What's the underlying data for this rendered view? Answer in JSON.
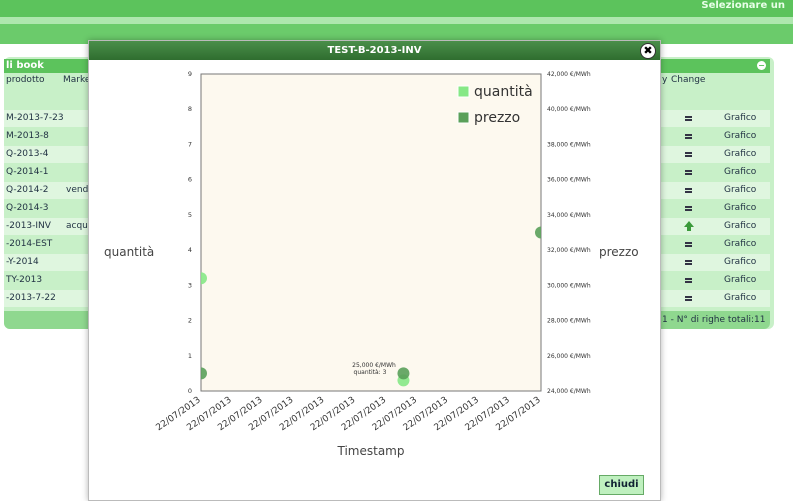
{
  "top": {
    "right_text": "Selezionare un"
  },
  "panel": {
    "title": "li book",
    "columns": {
      "prodotto": "prodotto",
      "market": "Marke",
      "y": "y",
      "change": "Change"
    },
    "rows": [
      {
        "prodotto": "M-2013-7-23",
        "market": "",
        "change": "eq",
        "link": "Grafico"
      },
      {
        "prodotto": "M-2013-8",
        "market": "",
        "change": "eq",
        "link": "Grafico"
      },
      {
        "prodotto": "Q-2013-4",
        "market": "",
        "change": "eq",
        "link": "Grafico"
      },
      {
        "prodotto": "Q-2014-1",
        "market": "",
        "change": "eq",
        "link": "Grafico"
      },
      {
        "prodotto": "Q-2014-2",
        "market": "vend",
        "change": "eq",
        "link": "Grafico"
      },
      {
        "prodotto": "Q-2014-3",
        "market": "",
        "change": "eq",
        "link": "Grafico"
      },
      {
        "prodotto": "-2013-INV",
        "market": "acqu",
        "change": "up",
        "link": "Grafico"
      },
      {
        "prodotto": "-2014-EST",
        "market": "",
        "change": "eq",
        "link": "Grafico"
      },
      {
        "prodotto": "-Y-2014",
        "market": "",
        "change": "eq",
        "link": "Grafico"
      },
      {
        "prodotto": "TY-2013",
        "market": "",
        "change": "eq",
        "link": "Grafico"
      },
      {
        "prodotto": "-2013-7-22",
        "market": "",
        "change": "eq",
        "link": "Grafico"
      }
    ],
    "footer": "1 - N° di righe totali:11"
  },
  "modal": {
    "title": "TEST-B-2013-INV",
    "close_label": "✖",
    "button": "chiudi"
  },
  "colors": {
    "quantita": "#86e886",
    "prezzo": "#5aa05a",
    "plot_bg": "#fdf9ef"
  },
  "chart_data": {
    "type": "scatter",
    "xlabel": "Timestamp",
    "ylabel": "quantità",
    "y2label": "prezzo",
    "ylim": [
      0,
      9
    ],
    "y2lim": [
      24000,
      42000
    ],
    "yticks": [
      "0",
      "1",
      "2",
      "3",
      "4",
      "5",
      "6",
      "7",
      "8",
      "9"
    ],
    "y2ticks": [
      "24,000 €/MWh",
      "26,000 €/MWh",
      "28,000 €/MWh",
      "30,000 €/MWh",
      "32,000 €/MWh",
      "34,000 €/MWh",
      "36,000 €/MWh",
      "38,000 €/MWh",
      "40,000 €/MWh",
      "42,000 €/MWh"
    ],
    "xticks": [
      "22/07/2013",
      "22/07/2013",
      "22/07/2013",
      "22/07/2013",
      "22/07/2013",
      "22/07/2013",
      "22/07/2013",
      "22/07/2013",
      "22/07/2013",
      "22/07/2013",
      "22/07/2013",
      "22/07/2013"
    ],
    "legend": [
      "quantità",
      "prezzo"
    ],
    "legend_position": "top-right",
    "annotation": {
      "line1": "25,000 €/MWh",
      "line2": "quantità: 3"
    },
    "series": [
      {
        "name": "quantità",
        "axis": "left",
        "points": [
          {
            "xi": 0,
            "y": 3.2
          },
          {
            "xi": 6.55,
            "y": 0.3
          }
        ]
      },
      {
        "name": "prezzo",
        "axis": "right",
        "points": [
          {
            "xi": 0,
            "y": 25000
          },
          {
            "xi": 6.55,
            "y": 25000
          },
          {
            "xi": 11,
            "y": 33000
          }
        ]
      }
    ]
  }
}
